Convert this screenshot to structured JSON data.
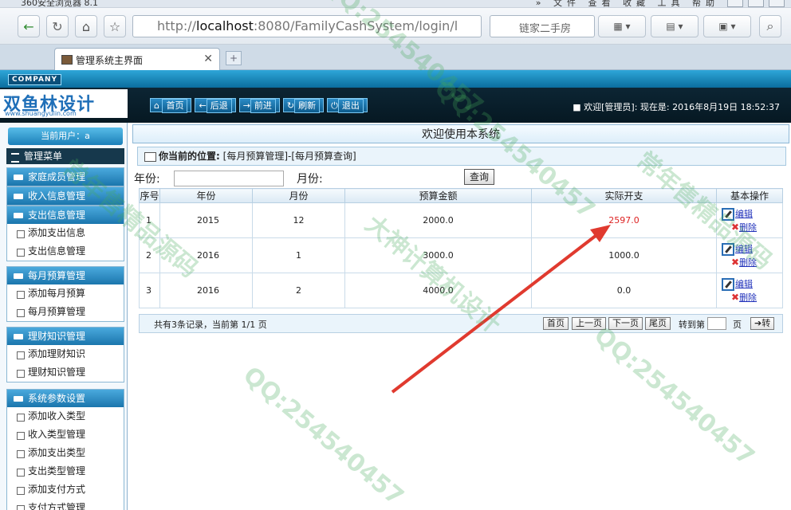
{
  "browser": {
    "title": "360安全浏览器 8.1",
    "menu": "» 文件 查看 收藏 工具 帮助",
    "url_prefix": "http://",
    "url_host": "localhost",
    "url_rest": ":8080/FamilyCashSystem/login/l",
    "search_text": "链家二手房",
    "tab_title": "管理系统主界面"
  },
  "header": {
    "company": "COMPANY",
    "logo_big": "双鱼林设计",
    "logo_small": "www.shuangyulin.com",
    "buttons": [
      "首页",
      "后退",
      "前进",
      "刷新",
      "退出"
    ],
    "welcome": "■ 欢迎[管理员]: 现在是: 2016年8月19日 18:52:37"
  },
  "sidebar": {
    "current_user": "当前用户：a",
    "manage_menu": "管理菜单",
    "sections": [
      {
        "title": "家庭成员管理",
        "items": []
      },
      {
        "title": "收入信息管理",
        "items": []
      },
      {
        "title": "支出信息管理",
        "items": [
          "添加支出信息",
          "支出信息管理"
        ]
      },
      {
        "title": "每月预算管理",
        "items": [
          "添加每月预算",
          "每月预算管理"
        ]
      },
      {
        "title": "理财知识管理",
        "items": [
          "添加理财知识",
          "理财知识管理"
        ]
      },
      {
        "title": "系统参数设置",
        "items": [
          "添加收入类型",
          "收入类型管理",
          "添加支出类型",
          "支出类型管理",
          "添加支付方式",
          "支付方式管理"
        ]
      }
    ]
  },
  "main": {
    "welcome_title": "欢迎使用本系统",
    "location_label": "你当前的位置:",
    "location_path": "[每月预算管理]-[每月预算查询]",
    "year_label": "年份:",
    "month_label": "月份:",
    "query_button": "查询",
    "columns": [
      "序号",
      "年份",
      "月份",
      "预算金额",
      "实际开支",
      "基本操作"
    ],
    "rows": [
      {
        "no": "1",
        "year": "2015",
        "month": "12",
        "budget": "2000.0",
        "actual": "2597.0",
        "over": true
      },
      {
        "no": "2",
        "year": "2016",
        "month": "1",
        "budget": "3000.0",
        "actual": "1000.0",
        "over": false
      },
      {
        "no": "3",
        "year": "2016",
        "month": "2",
        "budget": "4000.0",
        "actual": "0.0",
        "over": false
      }
    ],
    "edit_label": "编辑",
    "delete_label": "删除",
    "pager_info": "共有3条记录，当前第 1/1 页",
    "pager_buttons": [
      "首页",
      "上一页",
      "下一页",
      "尾页"
    ],
    "goto_label": "转到第",
    "page_label": "页",
    "goto_button": "转"
  },
  "watermarks": [
    "QQ:254540457",
    "大神计算机设计",
    "常年售精品源码"
  ],
  "colors": {
    "accent": "#1b76ad",
    "over_budget": "#dd2222",
    "arrow": "#e03a2f"
  }
}
